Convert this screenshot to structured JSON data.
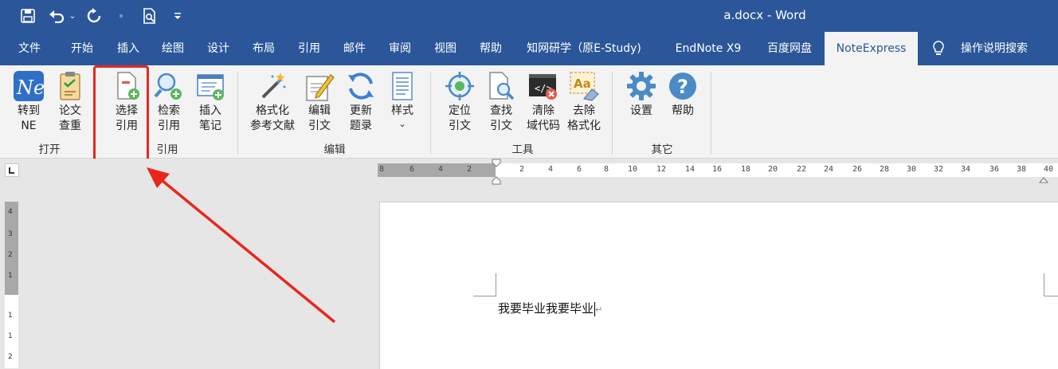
{
  "titlebar": {
    "title": "a.docx  -  Word"
  },
  "tabs": [
    "文件",
    "开始",
    "插入",
    "绘图",
    "设计",
    "布局",
    "引用",
    "邮件",
    "审阅",
    "视图",
    "帮助",
    "知网研学（原E-Study)",
    "EndNote X9",
    "百度网盘",
    "NoteExpress",
    "操作说明搜索"
  ],
  "active_tab": "NoteExpress",
  "ribbon": {
    "groups": {
      "open": "打开",
      "cite": "引用",
      "edit": "编辑",
      "tools": "工具",
      "other": "其它"
    },
    "buttons": {
      "to_ne": [
        "转到",
        "NE"
      ],
      "check_paper": [
        "论文",
        "查重"
      ],
      "select_cite": [
        "选择",
        "引用"
      ],
      "search_cite": [
        "检索",
        "引用"
      ],
      "insert_note": [
        "插入",
        "笔记"
      ],
      "format_ref": [
        "格式化",
        "参考文献"
      ],
      "edit_cite": [
        "编辑",
        "引文"
      ],
      "update_list": [
        "更新",
        "题录"
      ],
      "style": [
        "样式",
        "⌄"
      ],
      "locate_cite": [
        "定位",
        "引文"
      ],
      "find_cite": [
        "查找",
        "引文"
      ],
      "clear_code": [
        "清除",
        "域代码"
      ],
      "remove_format": [
        "去除",
        "格式化"
      ],
      "settings": [
        "设置"
      ],
      "help": [
        "帮助"
      ]
    }
  },
  "ruler": {
    "left_ticks": [
      "8",
      "6",
      "4",
      "2"
    ],
    "right_ticks": [
      "2",
      "4",
      "6",
      "8",
      "10",
      "12",
      "14",
      "16",
      "18",
      "20",
      "22",
      "24",
      "26",
      "28",
      "30",
      "32",
      "34",
      "36",
      "38",
      "40"
    ],
    "vertical_ticks": [
      "4",
      "3",
      "2",
      "1",
      "1",
      "1",
      "2"
    ]
  },
  "document": {
    "text": "我要毕业我要毕业"
  },
  "colors": {
    "brand": "#2b579a",
    "highlight": "#e8261e"
  }
}
